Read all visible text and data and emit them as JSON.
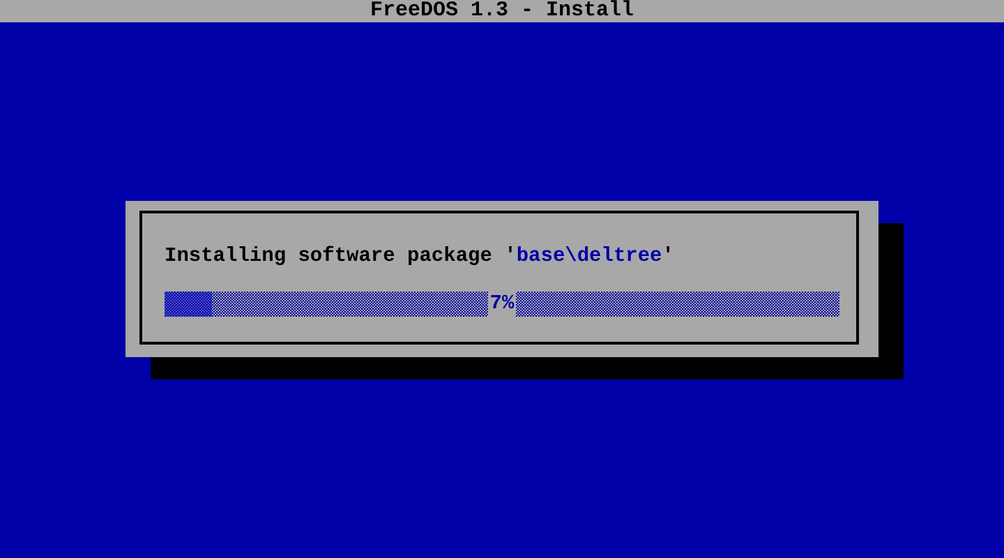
{
  "window": {
    "title": "FreeDOS 1.3 - Install"
  },
  "dialog": {
    "message_parts": [
      {
        "kind": "plain",
        "text": "Installing software package '"
      },
      {
        "kind": "highlight",
        "text": "base\\deltree"
      },
      {
        "kind": "plain",
        "text": "'"
      }
    ],
    "progress": {
      "level": 0.07,
      "reading": "7%"
    }
  }
}
